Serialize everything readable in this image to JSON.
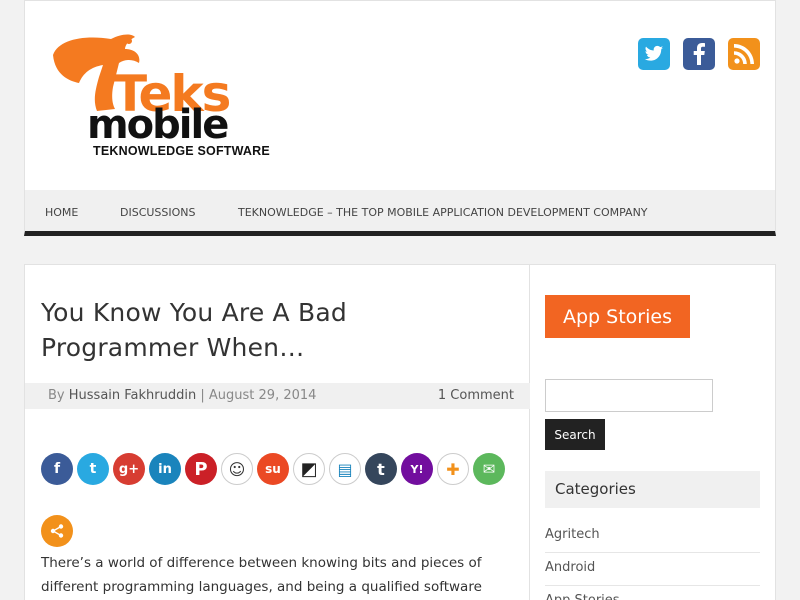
{
  "logo": {
    "word_teks": "Teks",
    "word_mobile": "mobile",
    "tagline": "TEKNOWLEDGE SOFTWARE"
  },
  "social_icons": [
    "twitter-icon",
    "facebook-icon",
    "rss-icon"
  ],
  "nav": {
    "items": [
      {
        "label": "HOME"
      },
      {
        "label": "DISCUSSIONS"
      },
      {
        "label": "TEKNOWLEDGE – THE TOP MOBILE APPLICATION DEVELOPMENT COMPANY"
      }
    ]
  },
  "post": {
    "title": "You Know You Are A Bad Programmer When…",
    "by_prefix": "By",
    "author": "Hussain Fakhruddin",
    "separator": "|",
    "date": "August 29, 2014",
    "comments": "1 Comment",
    "body_line1": "There’s a world of difference between knowing bits and pieces of",
    "body_line2": "different programming languages, and being a qualified software"
  },
  "share_buttons": [
    {
      "name": "facebook",
      "color": "#3b5b98",
      "glyph": "f"
    },
    {
      "name": "twitter",
      "color": "#29a9e1",
      "glyph": "t"
    },
    {
      "name": "google-plus",
      "color": "#d73d32",
      "glyph": "g+"
    },
    {
      "name": "linkedin",
      "color": "#1a84bc",
      "glyph": "in"
    },
    {
      "name": "pinterest",
      "color": "#cb2027",
      "glyph": "P"
    },
    {
      "name": "reddit",
      "color": "#ffffff",
      "glyph": "☺"
    },
    {
      "name": "stumbleupon",
      "color": "#eb4924",
      "glyph": "su"
    },
    {
      "name": "delicious",
      "color": "#ffffff",
      "glyph": "◩"
    },
    {
      "name": "digg",
      "color": "#ffffff",
      "glyph": "▤"
    },
    {
      "name": "tumblr",
      "color": "#35465c",
      "glyph": "t"
    },
    {
      "name": "yahoo",
      "color": "#720e9e",
      "glyph": "Y!"
    },
    {
      "name": "vkontakte",
      "color": "#ffffff",
      "glyph": "✚"
    },
    {
      "name": "email",
      "color": "#5cb85c",
      "glyph": "✉"
    }
  ],
  "share_more_color": "#f2911b",
  "sidebar": {
    "app_stories": "App Stories",
    "search_placeholder": "",
    "search_button": "Search",
    "categories_title": "Categories",
    "categories": [
      {
        "label": "Agritech"
      },
      {
        "label": "Android"
      },
      {
        "label": "App Stories"
      }
    ]
  },
  "colors": {
    "accent": "#f26522",
    "nav_border": "#222222"
  }
}
